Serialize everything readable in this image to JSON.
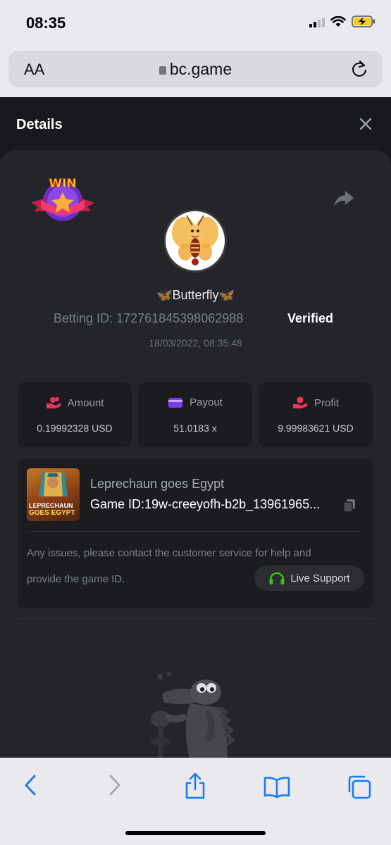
{
  "status_bar": {
    "time": "08:35"
  },
  "browser": {
    "text_size_label": "AA",
    "url": "bc.game"
  },
  "modal": {
    "title": "Details",
    "badge": "WIN",
    "player": {
      "name": "Butterfly",
      "emoji": "🦋"
    },
    "betting_id_label": "Betting ID:",
    "betting_id": "172761845398062988",
    "verified": "Verified",
    "timestamp": "18/03/2022, 08:35:48",
    "stats": [
      {
        "label": "Amount",
        "value": "0.19992328 USD",
        "icon": "coins-hand-icon"
      },
      {
        "label": "Payout",
        "value": "51.0183 x",
        "icon": "wallet-card-icon"
      },
      {
        "label": "Profit",
        "value": "9.99983621 USD",
        "icon": "profit-hand-icon"
      }
    ],
    "game": {
      "thumb_line1": "LEPRECHAUN",
      "thumb_line2": "GOES EGYPT",
      "name": "Leprechaun goes Egypt",
      "id_label": "Game ID:",
      "id": "19w-creeyofh-b2b_13961965..."
    },
    "notice_line1": "Any issues, please contact the customer service for help and",
    "notice_line2": "provide the game ID.",
    "live_support": "Live Support"
  },
  "colors": {
    "background": "#18191c",
    "panel": "#232528",
    "card": "#1b1c1f",
    "accent_pink": "#e8345e",
    "accent_purple": "#7b3cf0",
    "accent_green": "#3bc117",
    "ios_blue": "#1a7cf5"
  }
}
